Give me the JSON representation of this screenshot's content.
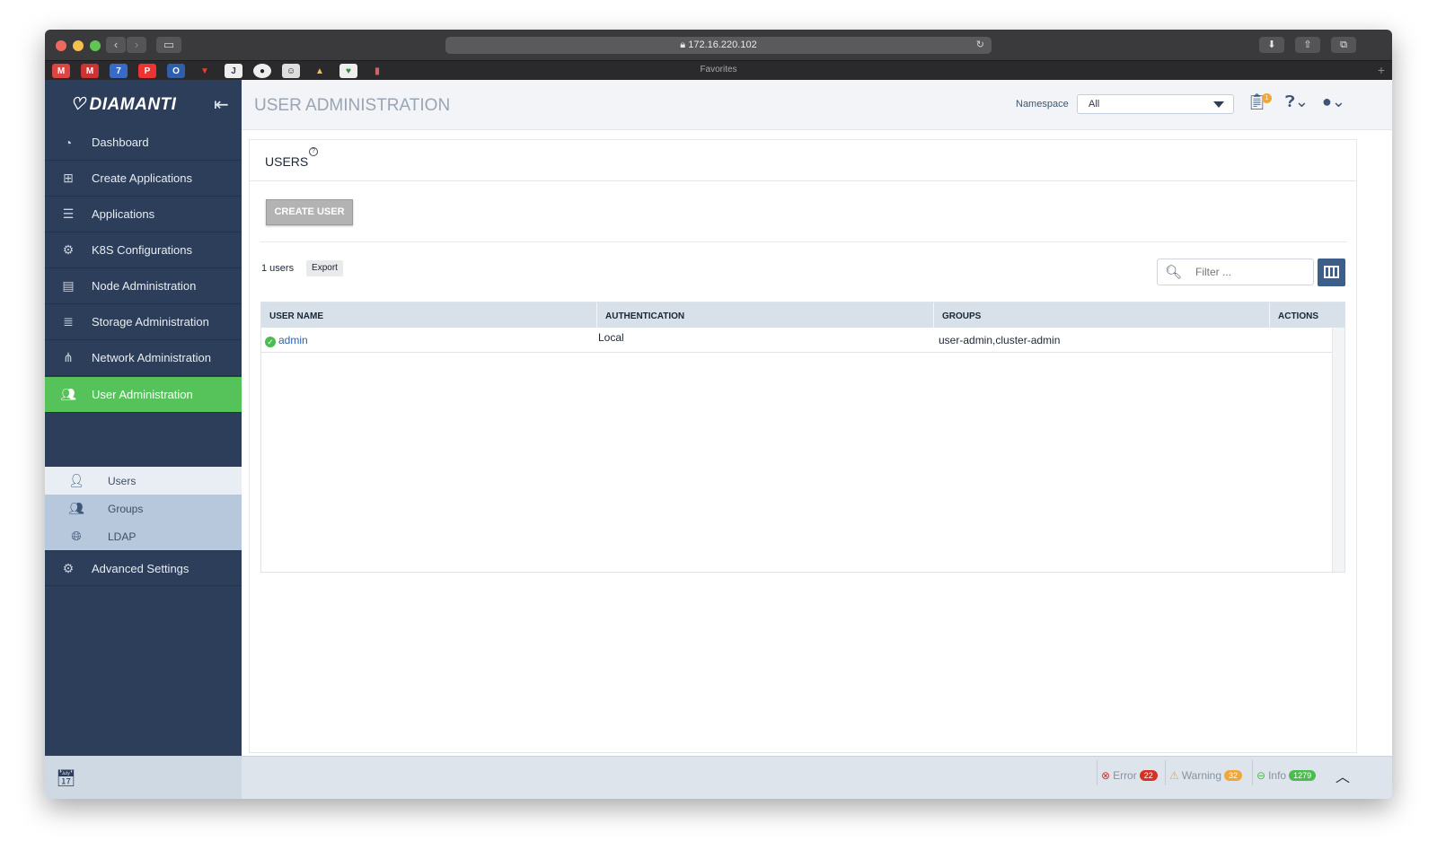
{
  "browser": {
    "url": "172.16.220.102",
    "favorites_label": "Favorites",
    "colors": {
      "close": "#ec6a5e",
      "minimize": "#f4bf4f",
      "maximize": "#61c554"
    }
  },
  "app": {
    "brand": "DIAMANTI",
    "page_title": "USER ADMINISTRATION",
    "namespace": {
      "label": "Namespace",
      "selected": "All"
    },
    "accent": "#56c35a",
    "sidebar_bg": "#2c3e5a"
  },
  "sidebar": {
    "items": [
      {
        "label": "Dashboard",
        "icon": "dashboard-icon"
      },
      {
        "label": "Create Applications",
        "icon": "plus-square-icon"
      },
      {
        "label": "Applications",
        "icon": "list-icon"
      },
      {
        "label": "K8S Configurations",
        "icon": "gears-icon"
      },
      {
        "label": "Node Administration",
        "icon": "server-icon"
      },
      {
        "label": "Storage Administration",
        "icon": "database-icon"
      },
      {
        "label": "Network Administration",
        "icon": "network-icon"
      },
      {
        "label": "User Administration",
        "icon": "users-icon",
        "active": true
      }
    ],
    "subitems": [
      {
        "label": "Users",
        "icon": "user-icon",
        "active": true
      },
      {
        "label": "Groups",
        "icon": "group-icon"
      },
      {
        "label": "LDAP",
        "icon": "globe-icon"
      }
    ],
    "advanced": {
      "label": "Advanced Settings",
      "icon": "settings-icon"
    }
  },
  "users_panel": {
    "heading": "USERS",
    "help": "?",
    "create_button": "CREATE USER",
    "count": "1 users",
    "export_button": "Export",
    "filter_placeholder": "Filter ...",
    "table": {
      "headers": [
        "USER NAME",
        "AUTHENTICATION",
        "GROUPS",
        "ACTIONS"
      ],
      "rows": [
        {
          "user": "admin",
          "auth": "Local",
          "groups": "user-admin,cluster-admin",
          "status": "ok"
        }
      ]
    }
  },
  "header": {
    "notification_badge": "1"
  },
  "statusbar": {
    "error": {
      "label": "Error",
      "count": "22",
      "color": "#d93025"
    },
    "warning": {
      "label": "Warning",
      "count": "32",
      "color": "#f0a73a"
    },
    "info": {
      "label": "Info",
      "count": "1279",
      "color": "#4cbb50"
    }
  }
}
